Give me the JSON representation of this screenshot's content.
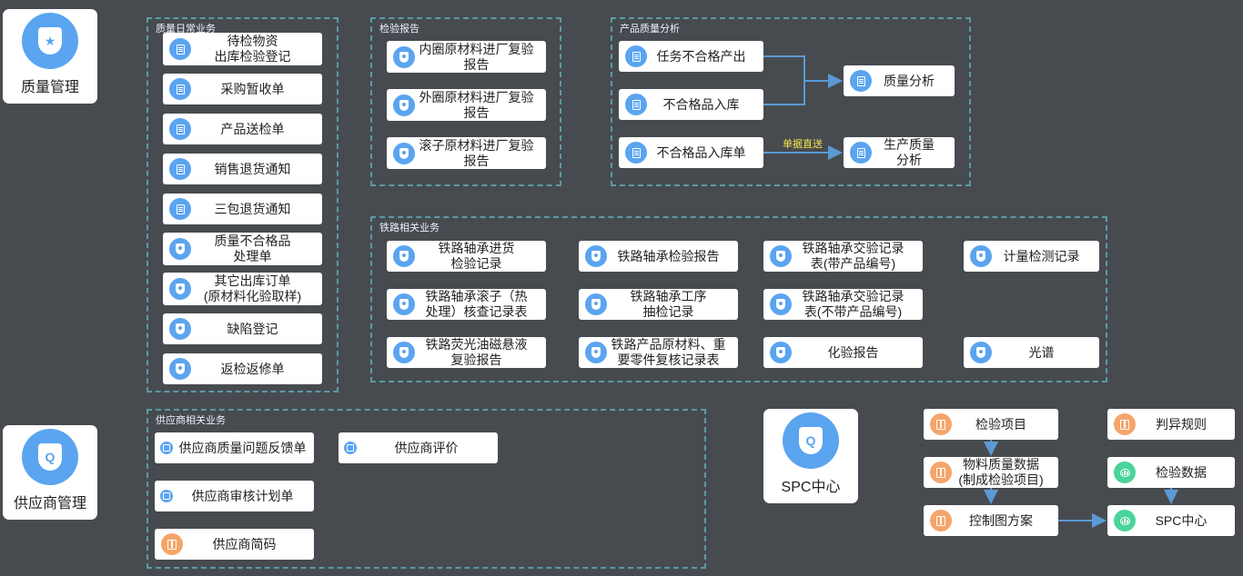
{
  "modules": {
    "quality": "质量管理",
    "supplier": "供应商管理",
    "spc": "SPC中心"
  },
  "groups": {
    "daily": "质量日常业务",
    "inspection_report": "检验报告",
    "product_quality": "产品质量分析",
    "railway": "铁路相关业务",
    "supplier_biz": "供应商相关业务"
  },
  "daily_items": [
    "待检物资\n出库检验登记",
    "采购暂收单",
    "产品送检单",
    "销售退货通知",
    "三包退货通知",
    "质量不合格品\n处理单",
    "其它出库订单\n(原材料化验取样)",
    "缺陷登记",
    "返检返修单"
  ],
  "inspection_items": [
    "内圈原材料进厂复验\n报告",
    "外圈原材料进厂复验\n报告",
    "滚子原材料进厂复验\n报告"
  ],
  "product_quality": {
    "task_unqualified": "任务不合格产出",
    "unqualified_in": "不合格品入库",
    "unqualified_in_order": "不合格品入库单",
    "quality_analysis": "质量分析",
    "production_analysis": "生产质量\n分析",
    "edge_label": "单据直送"
  },
  "railway_items": [
    "铁路轴承进货\n检验记录",
    "铁路轴承检验报告",
    "铁路轴承交验记录\n表(带产品编号)",
    "计量检测记录",
    "铁路轴承滚子（热\n处理）核查记录表",
    "铁路轴承工序\n抽检记录",
    "铁路轴承交验记录\n表(不带产品编号)",
    "铁路荧光油磁悬液\n复验报告",
    "铁路产品原材料、重\n要零件复核记录表",
    "化验报告",
    "光谱"
  ],
  "supplier_items": {
    "feedback": "供应商质量问题反馈单",
    "evaluation": "供应商评价",
    "audit_plan": "供应商审核计划单",
    "shortcode": "供应商简码"
  },
  "spc_items": {
    "inspection_item": "检验项目",
    "material_data": "物料质量数据\n(制成检验项目)",
    "control_chart": "控制图方案",
    "judge_rule": "判异规则",
    "inspection_data": "检验数据",
    "spc_center": "SPC中心"
  },
  "colors": {
    "background": "#474b50",
    "dashed_border": "#5b9aa5",
    "blue_icon": "#5aa4f0",
    "orange_icon": "#f5a56a",
    "green_icon": "#4bd49a",
    "arrow": "#5b9ad5",
    "edge_label": "#f7e34a"
  }
}
